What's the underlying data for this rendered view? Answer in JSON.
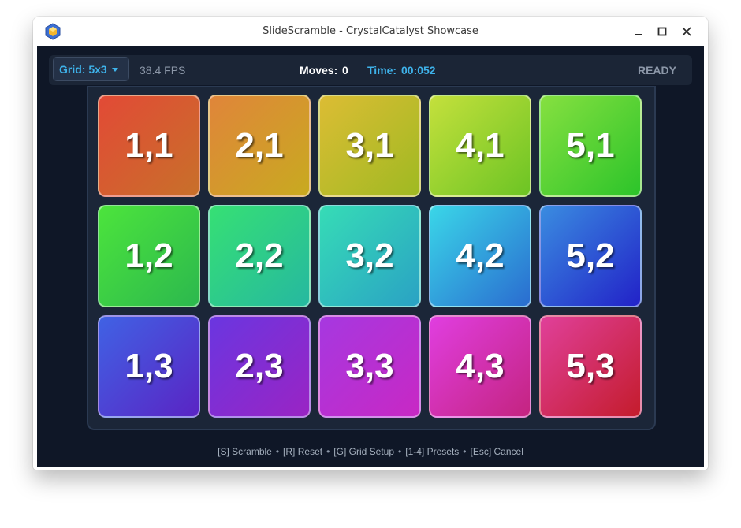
{
  "window": {
    "title": "SlideScramble - CrystalCatalyst Showcase",
    "app_icon": "crystal-hexagon-icon",
    "controls": [
      "minimize-icon",
      "maximize-icon",
      "close-icon"
    ]
  },
  "toolbar": {
    "grid_label": "Grid: 5x3",
    "fps": "38.4 FPS",
    "moves_label": "Moves:",
    "moves_value": "0",
    "time_label": "Time:",
    "time_value": "00:052",
    "status": "READY",
    "accent_color": "#3eb2ea"
  },
  "board": {
    "columns": 5,
    "rows": 3,
    "tiles": [
      {
        "label": "1,1",
        "colors": [
          "#e24a36",
          "#c8702a"
        ]
      },
      {
        "label": "2,1",
        "colors": [
          "#e0853a",
          "#c8aa20"
        ]
      },
      {
        "label": "3,1",
        "colors": [
          "#dcbc34",
          "#9fba22"
        ]
      },
      {
        "label": "4,1",
        "colors": [
          "#c4e03c",
          "#6cc424"
        ]
      },
      {
        "label": "5,1",
        "colors": [
          "#86e040",
          "#2cc42a"
        ]
      },
      {
        "label": "1,2",
        "colors": [
          "#4ce43c",
          "#2cb84e"
        ]
      },
      {
        "label": "2,2",
        "colors": [
          "#36e074",
          "#26b8a0"
        ]
      },
      {
        "label": "3,2",
        "colors": [
          "#36dcb6",
          "#2aa2c4"
        ]
      },
      {
        "label": "4,2",
        "colors": [
          "#3ad6e8",
          "#2a6cd0"
        ]
      },
      {
        "label": "5,2",
        "colors": [
          "#3a8ce0",
          "#2222c8"
        ]
      },
      {
        "label": "1,3",
        "colors": [
          "#4062e4",
          "#5a24c4"
        ]
      },
      {
        "label": "2,3",
        "colors": [
          "#6a36e0",
          "#9a24c4"
        ]
      },
      {
        "label": "3,3",
        "colors": [
          "#a638e0",
          "#c828c4"
        ]
      },
      {
        "label": "4,3",
        "colors": [
          "#e03ee0",
          "#c42480"
        ]
      },
      {
        "label": "5,3",
        "colors": [
          "#e0409a",
          "#c41c2c"
        ]
      }
    ]
  },
  "hints": [
    {
      "key": "[S]",
      "action": "Scramble"
    },
    {
      "key": "[R]",
      "action": "Reset"
    },
    {
      "key": "[G]",
      "action": "Grid Setup"
    },
    {
      "key": "[1-4]",
      "action": "Presets"
    },
    {
      "key": "[Esc]",
      "action": "Cancel"
    }
  ]
}
